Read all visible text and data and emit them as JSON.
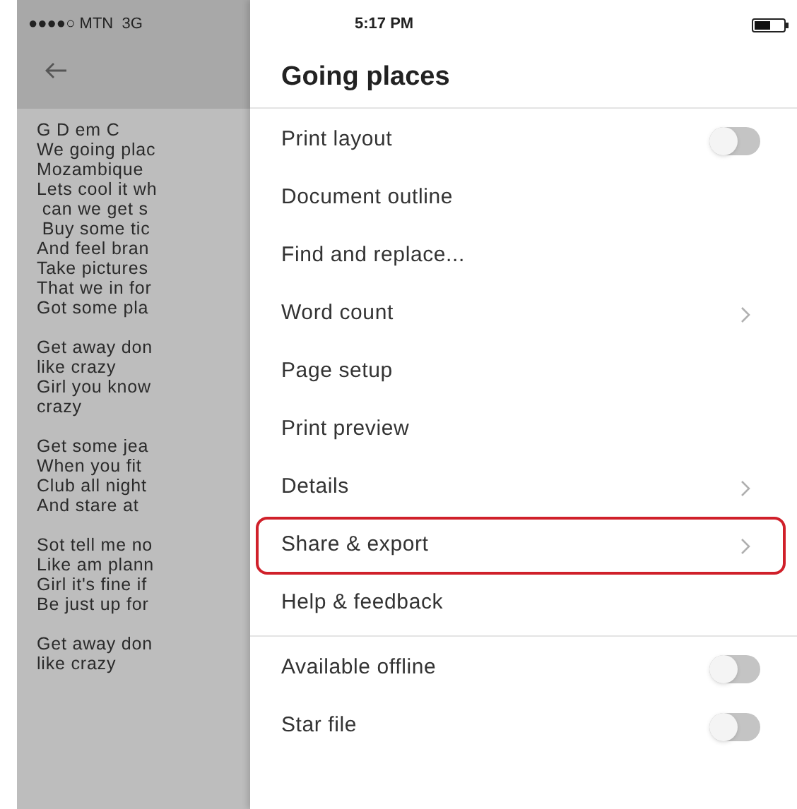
{
  "status_bar": {
    "carrier": "●●●●○ MTN  3G",
    "time": "5:17 PM"
  },
  "document": {
    "paragraphs": [
      [
        "G D em C",
        "We going plac",
        "Mozambique",
        "Lets cool it wh",
        " can we get s",
        " Buy some tic",
        "And feel bran",
        "Take pictures",
        "That we in for",
        "Got some pla"
      ],
      [
        "Get away don",
        "like crazy",
        "Girl you know",
        "crazy"
      ],
      [
        "Get some jea",
        "When you fit",
        "Club all night",
        "And stare at"
      ],
      [
        "Sot tell me no",
        "Like am plann",
        "Girl it's fine if",
        "Be just up for"
      ],
      [
        "Get away don",
        "like crazy"
      ]
    ]
  },
  "menu": {
    "title": "Going places",
    "groups": [
      [
        {
          "label": "Print layout",
          "kind": "toggle",
          "on": false,
          "highlighted": false
        },
        {
          "label": "Document outline",
          "kind": "plain",
          "highlighted": false
        },
        {
          "label": "Find and replace...",
          "kind": "plain",
          "highlighted": false
        },
        {
          "label": "Word count",
          "kind": "chevron",
          "highlighted": false
        },
        {
          "label": "Page setup",
          "kind": "plain",
          "highlighted": false
        },
        {
          "label": "Print preview",
          "kind": "plain",
          "highlighted": false
        },
        {
          "label": "Details",
          "kind": "chevron",
          "highlighted": false
        },
        {
          "label": "Share & export",
          "kind": "chevron",
          "highlighted": true
        },
        {
          "label": "Help & feedback",
          "kind": "plain",
          "highlighted": false
        }
      ],
      [
        {
          "label": "Available offline",
          "kind": "toggle",
          "on": false,
          "highlighted": false
        },
        {
          "label": "Star file",
          "kind": "toggle",
          "on": false,
          "highlighted": false
        }
      ]
    ]
  }
}
